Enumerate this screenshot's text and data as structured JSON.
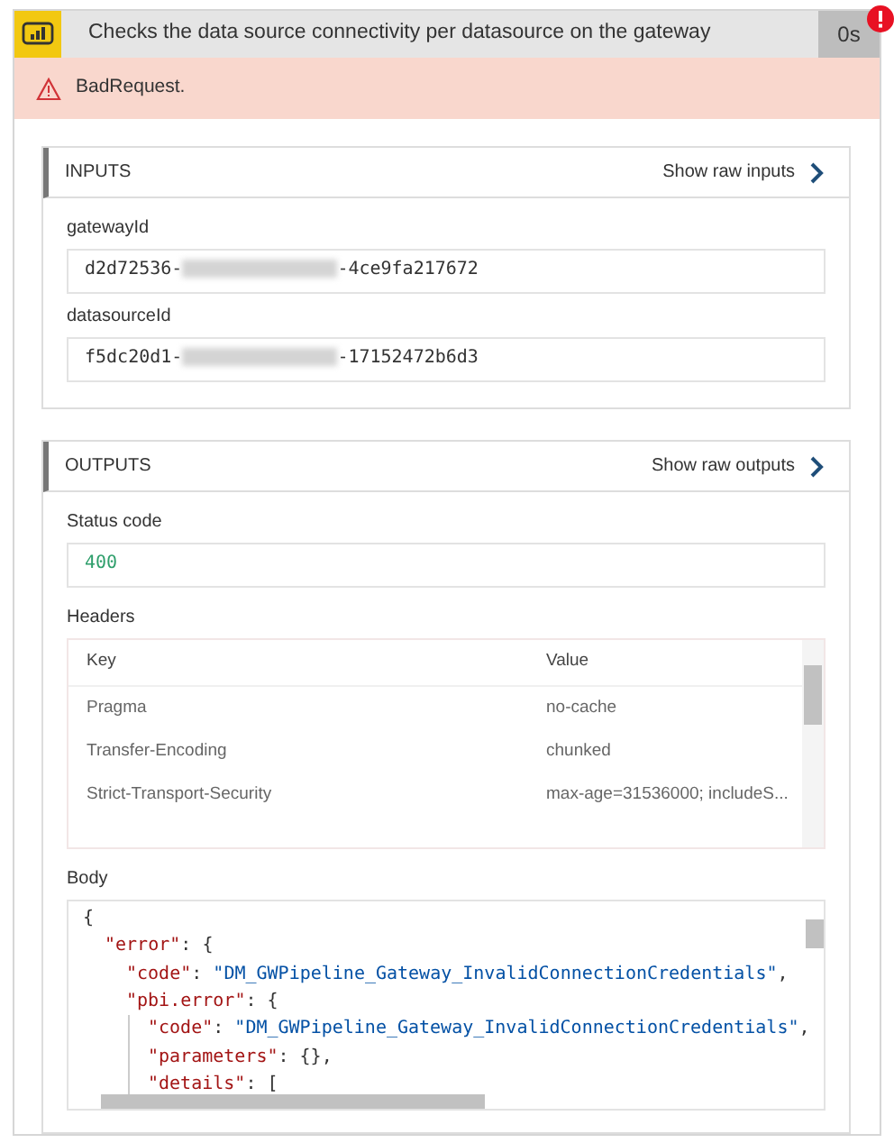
{
  "action": {
    "title": "Checks the data source connectivity per datasource on the gateway",
    "duration": "0s",
    "failed": true
  },
  "error": {
    "message": "BadRequest."
  },
  "inputs": {
    "heading": "INPUTS",
    "raw_link": "Show raw inputs",
    "fields": [
      {
        "label": "gatewayId",
        "prefix": "d2d72536-",
        "suffix": "-4ce9fa217672"
      },
      {
        "label": "datasourceId",
        "prefix": "f5dc20d1-",
        "suffix": "-17152472b6d3"
      }
    ]
  },
  "outputs": {
    "heading": "OUTPUTS",
    "raw_link": "Show raw outputs",
    "status_label": "Status code",
    "status_code": "400",
    "headers_label": "Headers",
    "headers": {
      "columns": [
        "Key",
        "Value"
      ],
      "rows": [
        [
          "Pragma",
          "no-cache"
        ],
        [
          "Transfer-Encoding",
          "chunked"
        ],
        [
          "Strict-Transport-Security",
          "max-age=31536000; includeS..."
        ]
      ]
    },
    "body_label": "Body",
    "body_lines": [
      {
        "tokens": [
          {
            "kind": "punct",
            "text": "{"
          }
        ],
        "children": [
          {
            "tokens": [
              {
                "kind": "key",
                "text": "\"error\""
              },
              {
                "kind": "punct",
                "text": ": {"
              }
            ],
            "children": [
              {
                "tokens": [
                  {
                    "kind": "key",
                    "text": "\"code\""
                  },
                  {
                    "kind": "punct",
                    "text": ": "
                  },
                  {
                    "kind": "string",
                    "text": "\"DM_GWPipeline_Gateway_InvalidConnectionCredentials\""
                  },
                  {
                    "kind": "punct",
                    "text": ","
                  }
                ]
              },
              {
                "tokens": [
                  {
                    "kind": "key",
                    "text": "\"pbi.error\""
                  },
                  {
                    "kind": "punct",
                    "text": ": {"
                  }
                ],
                "children": [
                  {
                    "tokens": [
                      {
                        "kind": "key",
                        "text": "\"code\""
                      },
                      {
                        "kind": "punct",
                        "text": ": "
                      },
                      {
                        "kind": "string",
                        "text": "\"DM_GWPipeline_Gateway_InvalidConnectionCredentials\""
                      },
                      {
                        "kind": "punct",
                        "text": ","
                      }
                    ]
                  },
                  {
                    "tokens": [
                      {
                        "kind": "key",
                        "text": "\"parameters\""
                      },
                      {
                        "kind": "punct",
                        "text": ": {},"
                      }
                    ]
                  },
                  {
                    "tokens": [
                      {
                        "kind": "key",
                        "text": "\"details\""
                      },
                      {
                        "kind": "punct",
                        "text": ": ["
                      }
                    ]
                  }
                ]
              }
            ]
          }
        ]
      }
    ]
  }
}
